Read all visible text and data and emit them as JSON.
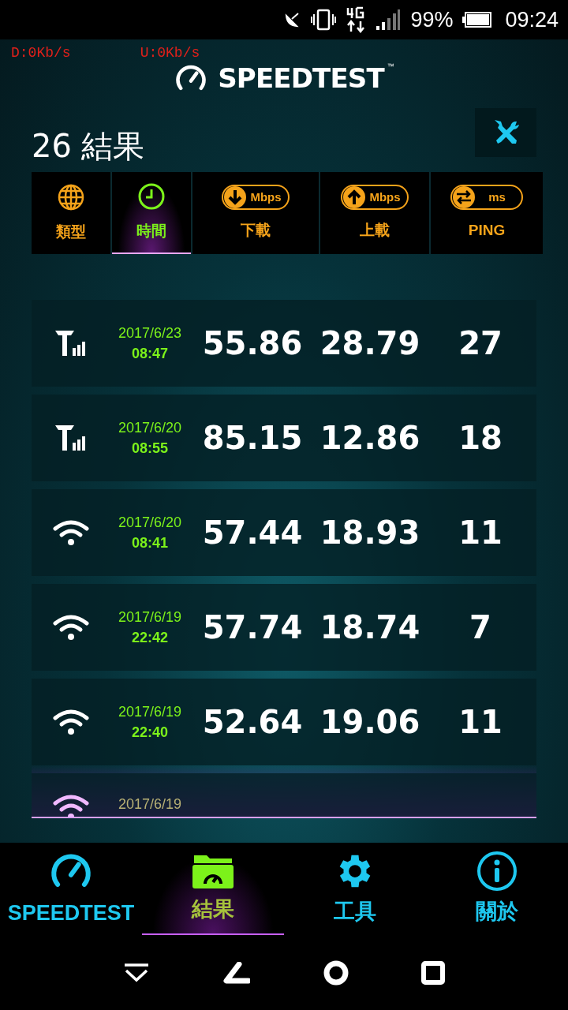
{
  "status_bar": {
    "battery": "99%",
    "time": "09:24"
  },
  "speed_overlay": {
    "download": "D:0Kb/s",
    "upload": "U:0Kb/s"
  },
  "header": {
    "logo_text": "SPEEDTEST",
    "trademark": "™"
  },
  "results": {
    "count": "26",
    "title": "結果"
  },
  "sort_columns": [
    {
      "kind": "type",
      "label": "類型",
      "selected": false
    },
    {
      "kind": "time",
      "label": "時間",
      "selected": true
    },
    {
      "kind": "download",
      "label": "下載",
      "unit": "Mbps",
      "selected": false
    },
    {
      "kind": "upload",
      "label": "上載",
      "unit": "Mbps",
      "selected": false
    },
    {
      "kind": "ping",
      "label": "PING",
      "unit": "ms",
      "selected": false
    }
  ],
  "rows": [
    {
      "kind": "cellular",
      "date": "2017/6/23",
      "time": "08:47",
      "download": "55.86",
      "upload": "28.79",
      "ping": "27"
    },
    {
      "kind": "cellular",
      "date": "2017/6/20",
      "time": "08:55",
      "download": "85.15",
      "upload": "12.86",
      "ping": "18"
    },
    {
      "kind": "wifi",
      "date": "2017/6/20",
      "time": "08:41",
      "download": "57.44",
      "upload": "18.93",
      "ping": "11"
    },
    {
      "kind": "wifi",
      "date": "2017/6/19",
      "time": "22:42",
      "download": "57.74",
      "upload": "18.74",
      "ping": "7"
    },
    {
      "kind": "wifi",
      "date": "2017/6/19",
      "time": "22:40",
      "download": "52.64",
      "upload": "19.06",
      "ping": "11"
    },
    {
      "kind": "wifi",
      "date": "2017/6/19"
    }
  ],
  "bottom_nav": [
    {
      "kind": "speedtest",
      "label": "SPEEDTEST",
      "selected": false
    },
    {
      "kind": "results",
      "label": "結果",
      "selected": true
    },
    {
      "kind": "tools",
      "label": "工具",
      "selected": false
    },
    {
      "kind": "about",
      "label": "關於",
      "selected": false
    }
  ]
}
